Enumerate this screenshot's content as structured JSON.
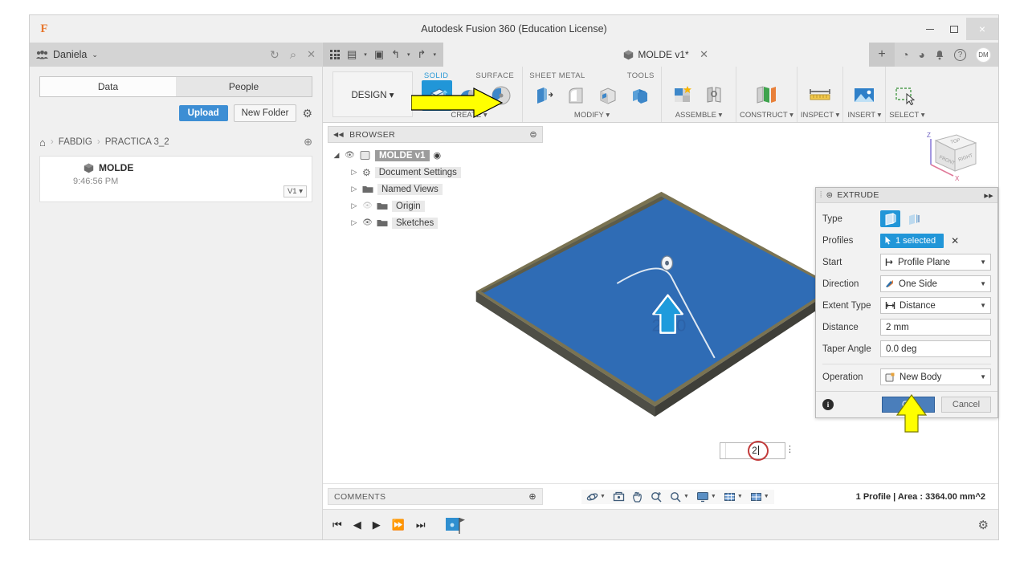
{
  "window": {
    "title": "Autodesk Fusion 360 (Education License)",
    "logo": "F",
    "minimize_label": "–",
    "maximize_label": "□",
    "close_label": "×"
  },
  "data_panel": {
    "hub_name": "Daniela",
    "hub_chevron": "⌄",
    "refresh_icon": "↻",
    "search_icon": "⌕",
    "close_icon": "✕",
    "tabs": [
      {
        "label": "Data",
        "active": true
      },
      {
        "label": "People",
        "active": false
      }
    ],
    "upload_label": "Upload",
    "new_folder_label": "New Folder",
    "settings_icon": "⚙",
    "breadcrumb": {
      "home_icon": "⌂",
      "separator": "›",
      "items": [
        "FABDIG",
        "PRACTICA 3_2"
      ],
      "globe_icon": "⊕"
    },
    "file": {
      "name": "MOLDE",
      "time": "9:46:56 PM",
      "version": "V1 ▾"
    }
  },
  "tabstrip": {
    "grid_icon": "grid",
    "new_doc_icon": "▤",
    "save_icon": "▣",
    "undo_icon": "↰",
    "redo_icon": "↱",
    "caret": "▾",
    "document_title": "MOLDE v1*",
    "close_tab": "✕",
    "add_tab": "+",
    "icons": [
      {
        "name": "job-status-icon",
        "glyph": "◔"
      },
      {
        "name": "recent-icon",
        "glyph": "◕"
      },
      {
        "name": "notifications-icon",
        "glyph": "🔔"
      },
      {
        "name": "help-icon",
        "glyph": "?"
      }
    ],
    "avatar_initials": "DM"
  },
  "ribbon": {
    "workspace_label": "DESIGN ▾",
    "groups": [
      {
        "title": "SOLID",
        "foot": "CREATE ▾",
        "active_title": true
      },
      {
        "title": "SURFACE",
        "foot": ""
      },
      {
        "title": "SHEET METAL",
        "foot": "MODIFY ▾"
      },
      {
        "title": "TOOLS",
        "foot": ""
      },
      {
        "title": "",
        "foot": "ASSEMBLE ▾"
      },
      {
        "title": "",
        "foot": "CONSTRUCT ▾"
      },
      {
        "title": "",
        "foot": "INSPECT ▾"
      },
      {
        "title": "",
        "foot": "INSERT ▾"
      },
      {
        "title": "",
        "foot": "SELECT ▾"
      }
    ]
  },
  "browser": {
    "header": "BROWSER",
    "collapse_icon": "◀◀",
    "dot_icon": "⊜",
    "nodes": [
      {
        "label": "MOLDE v1",
        "level": 0,
        "root": true,
        "eye": "◉",
        "caret": "◢"
      },
      {
        "label": "Document Settings",
        "level": 1,
        "icon": "gear",
        "caret": "▷"
      },
      {
        "label": "Named Views",
        "level": 1,
        "icon": "folder",
        "caret": "▷"
      },
      {
        "label": "Origin",
        "level": 1,
        "icon": "folder",
        "caret": "▷",
        "dim_eye": true
      },
      {
        "label": "Sketches",
        "level": 1,
        "icon": "sketch",
        "caret": "▷"
      }
    ]
  },
  "viewcube": {
    "axis_z": "Z",
    "axis_x": "X",
    "face_top": "TOP",
    "face_front": "FRONT",
    "face_right": "RIGHT"
  },
  "extrude_dialog": {
    "title": "EXTRUDE",
    "collapse_icon": "⊜",
    "expand_icon": "▸▸",
    "rows": [
      {
        "label": "Type",
        "kind": "typebuttons"
      },
      {
        "label": "Profiles",
        "kind": "selection",
        "value": "1 selected",
        "clear": "✕"
      },
      {
        "label": "Start",
        "kind": "dropdown",
        "value": "Profile Plane"
      },
      {
        "label": "Direction",
        "kind": "dropdown",
        "value": "One Side"
      },
      {
        "label": "Extent Type",
        "kind": "dropdown",
        "value": "Distance"
      },
      {
        "label": "Distance",
        "kind": "text",
        "value": "2 mm"
      },
      {
        "label": "Taper Angle",
        "kind": "text",
        "value": "0.0 deg"
      },
      {
        "label": "Operation",
        "kind": "dropdown",
        "value": "New Body"
      }
    ],
    "info_icon": "i",
    "ok_label": "OK",
    "cancel_label": "Cancel"
  },
  "inline_input": {
    "value": "2"
  },
  "statusbar": {
    "comments_label": "COMMENTS",
    "comments_dot": "⊕",
    "nav_tools": [
      {
        "name": "orbit-icon",
        "glyph": "⟳",
        "caret": "▾"
      },
      {
        "name": "look-at-icon",
        "glyph": "▣",
        "caret": ""
      },
      {
        "name": "pan-icon",
        "glyph": "✋",
        "caret": ""
      },
      {
        "name": "zoom-icon",
        "glyph": "⌕",
        "caret": ""
      },
      {
        "name": "zoom-window-icon",
        "glyph": "⌕",
        "caret": "▾"
      },
      {
        "name": "display-settings-icon",
        "glyph": "🖥",
        "caret": "▾"
      },
      {
        "name": "grid-snap-icon",
        "glyph": "▦",
        "caret": "▾"
      },
      {
        "name": "viewports-icon",
        "glyph": "⊞",
        "caret": "▾"
      }
    ],
    "info_text": "1 Profile | Area : 3364.00 mm^2"
  },
  "timeline": {
    "buttons": [
      "⏮",
      "◀",
      "▶",
      "⏩",
      "⏭"
    ],
    "settings_icon": "⚙"
  },
  "colors": {
    "accent_blue": "#2196d8",
    "select_blue": "#3d8ed4",
    "model_blue": "#2f6cb5",
    "annotation_yellow": "#ffff00",
    "annotation_red": "#c23a3a"
  }
}
